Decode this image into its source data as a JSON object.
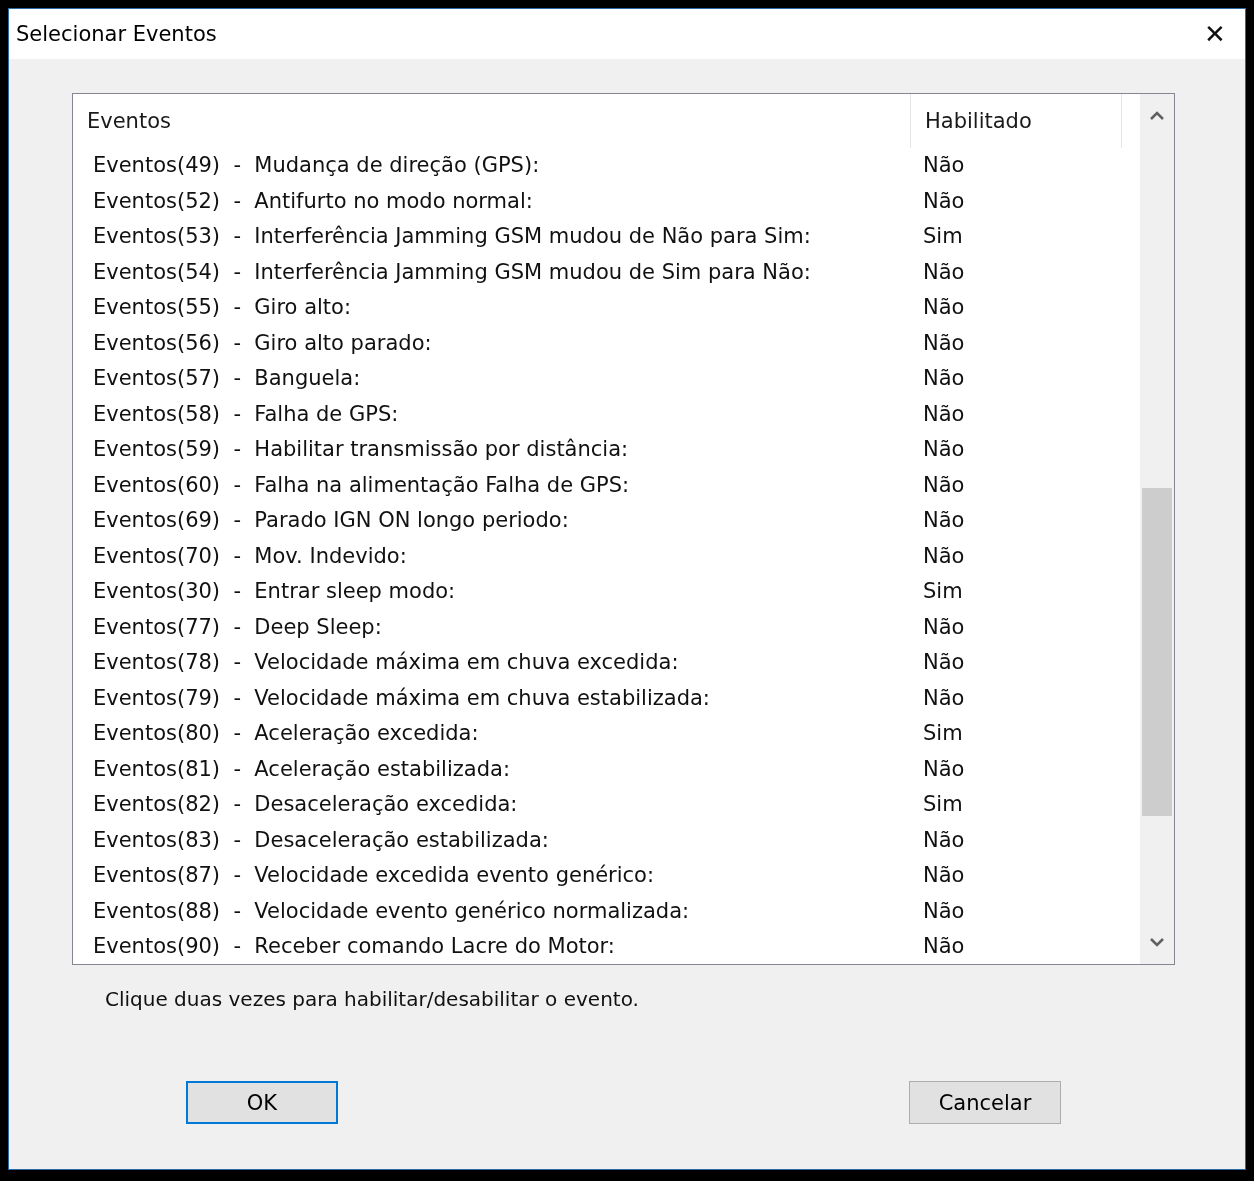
{
  "window": {
    "title": "Selecionar Eventos",
    "close": "✕"
  },
  "table": {
    "columns": [
      "Eventos",
      "Habilitado"
    ],
    "rows": [
      {
        "event": "Eventos(49)  -  Mudança de direção (GPS):",
        "enabled": "Não"
      },
      {
        "event": "Eventos(52)  -  Antifurto no modo normal:",
        "enabled": "Não"
      },
      {
        "event": "Eventos(53)  -  Interferência Jamming GSM mudou de Não para Sim:",
        "enabled": "Sim"
      },
      {
        "event": "Eventos(54)  -  Interferência Jamming GSM mudou de Sim para Não:",
        "enabled": "Não"
      },
      {
        "event": "Eventos(55)  -  Giro alto:",
        "enabled": "Não"
      },
      {
        "event": "Eventos(56)  -  Giro alto parado:",
        "enabled": "Não"
      },
      {
        "event": "Eventos(57)  -  Banguela:",
        "enabled": "Não"
      },
      {
        "event": "Eventos(58)  -  Falha de GPS:",
        "enabled": "Não"
      },
      {
        "event": "Eventos(59)  -  Habilitar transmissão por distância:",
        "enabled": "Não"
      },
      {
        "event": "Eventos(60)  -  Falha na alimentação Falha de GPS:",
        "enabled": "Não"
      },
      {
        "event": "Eventos(69)  -  Parado IGN ON longo periodo:",
        "enabled": "Não"
      },
      {
        "event": "Eventos(70)  -  Mov. Indevido:",
        "enabled": "Não"
      },
      {
        "event": "Eventos(30)  -  Entrar sleep modo:",
        "enabled": "Sim"
      },
      {
        "event": "Eventos(77)  -  Deep Sleep:",
        "enabled": "Não"
      },
      {
        "event": "Eventos(78)  -  Velocidade máxima em chuva excedida:",
        "enabled": "Não"
      },
      {
        "event": "Eventos(79)  -  Velocidade máxima em chuva estabilizada:",
        "enabled": "Não"
      },
      {
        "event": "Eventos(80)  -  Aceleração excedida:",
        "enabled": "Sim"
      },
      {
        "event": "Eventos(81)  -  Aceleração estabilizada:",
        "enabled": "Não"
      },
      {
        "event": "Eventos(82)  -  Desaceleração excedida:",
        "enabled": "Sim"
      },
      {
        "event": "Eventos(83)  -  Desaceleração estabilizada:",
        "enabled": "Não"
      },
      {
        "event": "Eventos(87)  -  Velocidade excedida evento genérico:",
        "enabled": "Não"
      },
      {
        "event": "Eventos(88)  -  Velocidade evento genérico normalizada:",
        "enabled": "Não"
      },
      {
        "event": "Eventos(90)  -  Receber comando Lacre do Motor:",
        "enabled": "Não"
      }
    ]
  },
  "hint": "Clique duas vezes para habilitar/desabilitar o evento.",
  "buttons": [
    {
      "label": "OK",
      "default": true
    },
    {
      "label": "Cancelar",
      "default": false
    }
  ]
}
